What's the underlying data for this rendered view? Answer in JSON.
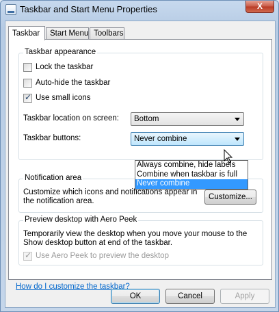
{
  "window": {
    "title": "Taskbar and Start Menu Properties",
    "close_label": "X"
  },
  "tabs": [
    {
      "label": "Taskbar",
      "active": true
    },
    {
      "label": "Start Menu",
      "active": false
    },
    {
      "label": "Toolbars",
      "active": false
    }
  ],
  "appearance": {
    "legend": "Taskbar appearance",
    "lock": {
      "label": "Lock the taskbar",
      "checked": false
    },
    "autohide": {
      "label": "Auto-hide the taskbar",
      "checked": false
    },
    "small_icons": {
      "label": "Use small icons",
      "checked": true
    },
    "location_label": "Taskbar location on screen:",
    "location_value": "Bottom",
    "buttons_label": "Taskbar buttons:",
    "buttons_value": "Never combine",
    "buttons_options": [
      "Always combine, hide labels",
      "Combine when taskbar is full",
      "Never combine"
    ],
    "buttons_selected_index": 2
  },
  "notification": {
    "legend": "Notification area",
    "description": "Customize which icons and notifications appear in the notification area.",
    "customize_label": "Customize..."
  },
  "aero_peek": {
    "legend": "Preview desktop with Aero Peek",
    "description": "Temporarily view the desktop when you move your mouse to the Show desktop button at end of the taskbar.",
    "checkbox": {
      "label": "Use Aero Peek to preview the desktop",
      "checked": true,
      "disabled": true
    }
  },
  "help_link": "How do I customize the taskbar?",
  "buttons": {
    "ok": "OK",
    "cancel": "Cancel",
    "apply": "Apply"
  },
  "colors": {
    "highlight": "#3399ff",
    "link": "#0066cc"
  }
}
